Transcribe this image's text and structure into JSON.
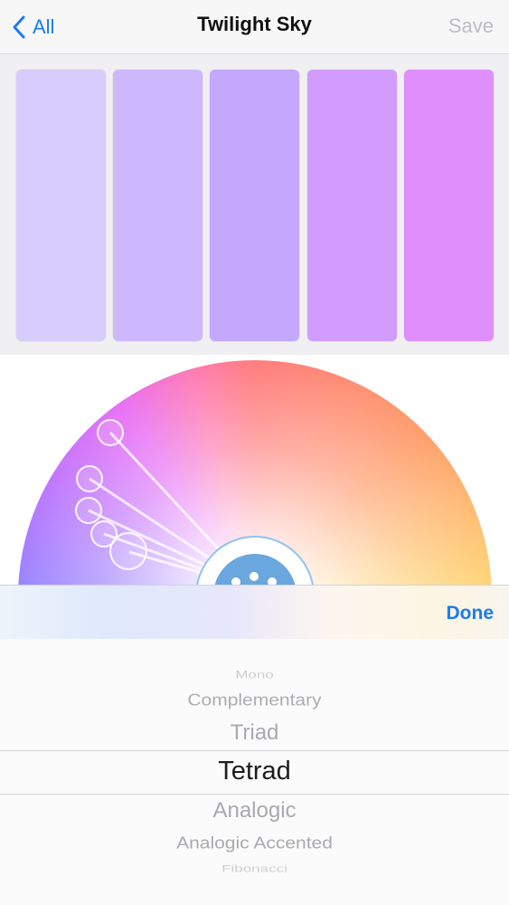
{
  "nav": {
    "back_label": "All",
    "title": "Twilight Sky",
    "save_label": "Save"
  },
  "palette": {
    "swatches": [
      {
        "color": "#d7cdfd"
      },
      {
        "color": "#cdb8fd"
      },
      {
        "color": "#c4a8fe"
      },
      {
        "color": "#d29cfe"
      },
      {
        "color": "#e08efc"
      }
    ]
  },
  "wheel": {
    "center_color": "#6aa7de",
    "ring_color": "#8fc3ee"
  },
  "toolbar": {
    "done_label": "Done"
  },
  "picker": {
    "options": [
      "Mono",
      "Complementary",
      "Triad",
      "Tetrad",
      "Analogic",
      "Analogic Accented",
      "Fibonacci"
    ],
    "selected": "Tetrad"
  }
}
